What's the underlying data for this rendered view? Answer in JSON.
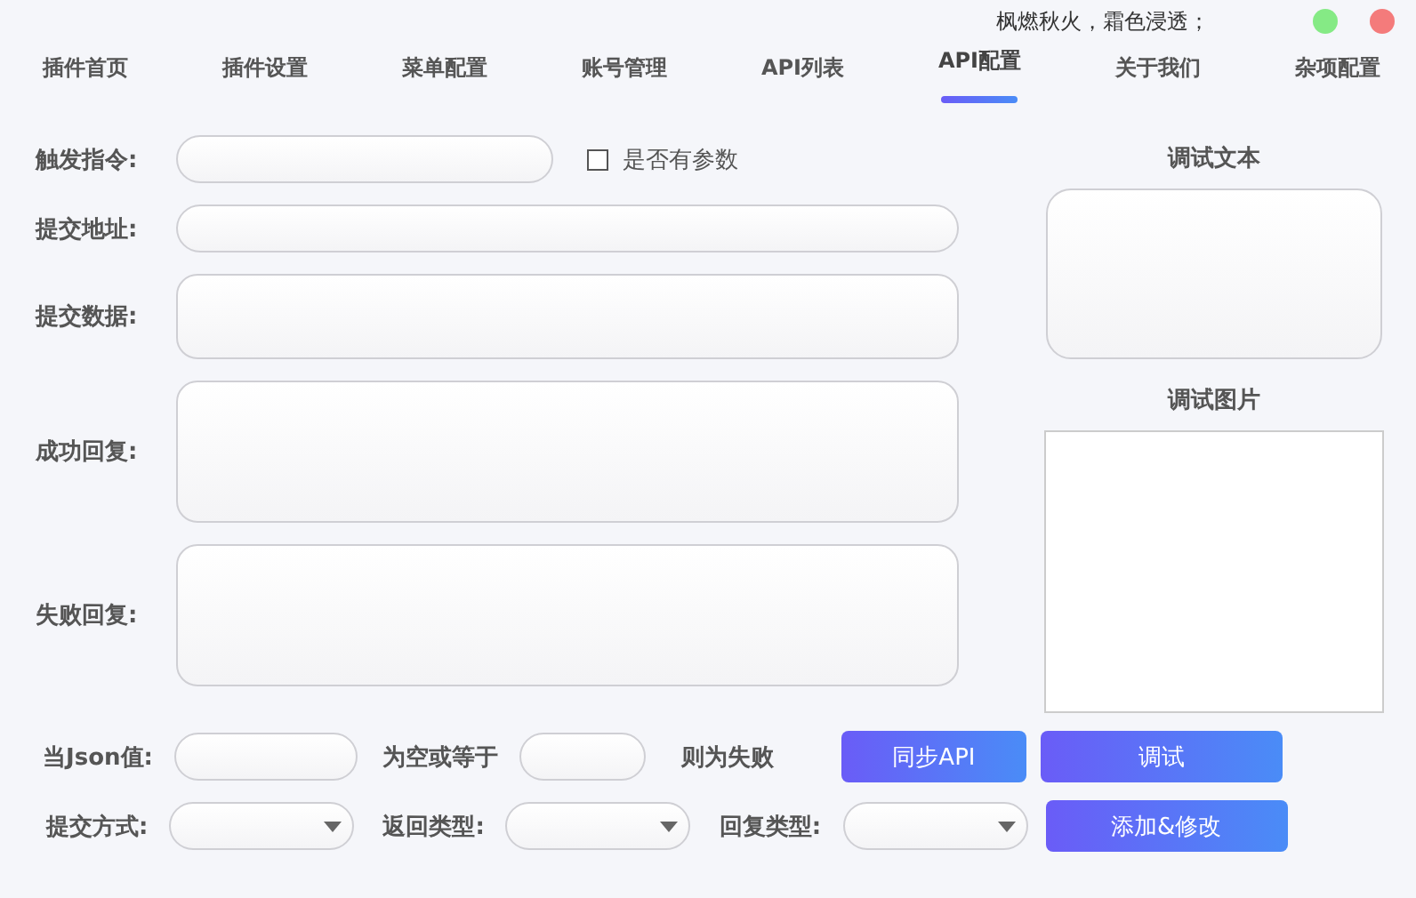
{
  "header": {
    "status_text": "枫燃秋火，霜色浸透；"
  },
  "tabs": [
    {
      "label": "插件首页",
      "selected": false
    },
    {
      "label": "插件设置",
      "selected": false
    },
    {
      "label": "菜单配置",
      "selected": false
    },
    {
      "label": "账号管理",
      "selected": false
    },
    {
      "label": "API列表",
      "selected": false
    },
    {
      "label": "API配置",
      "selected": true
    },
    {
      "label": "关于我们",
      "selected": false
    },
    {
      "label": "杂项配置",
      "selected": false
    }
  ],
  "form": {
    "trigger": {
      "label": "触发指令:"
    },
    "has_params": {
      "label": "是否有参数",
      "checked": false
    },
    "fields": [
      {
        "label": "提交地址:",
        "kind": "input"
      },
      {
        "label": "提交数据:",
        "kind": "small"
      },
      {
        "label": "成功回复:",
        "kind": "large"
      },
      {
        "label": "失败回复:",
        "kind": "large"
      }
    ]
  },
  "debug": {
    "text_label": "调试文本",
    "image_label": "调试图片"
  },
  "json_row": {
    "label": "当Json值:",
    "middle": "为空或等于",
    "end": "则为失败"
  },
  "select_row": [
    {
      "label": "提交方式:"
    },
    {
      "label": "返回类型:"
    },
    {
      "label": "回复类型:"
    }
  ],
  "buttons": {
    "sync": "同步API",
    "debug": "调试",
    "add": "添加&修改"
  }
}
